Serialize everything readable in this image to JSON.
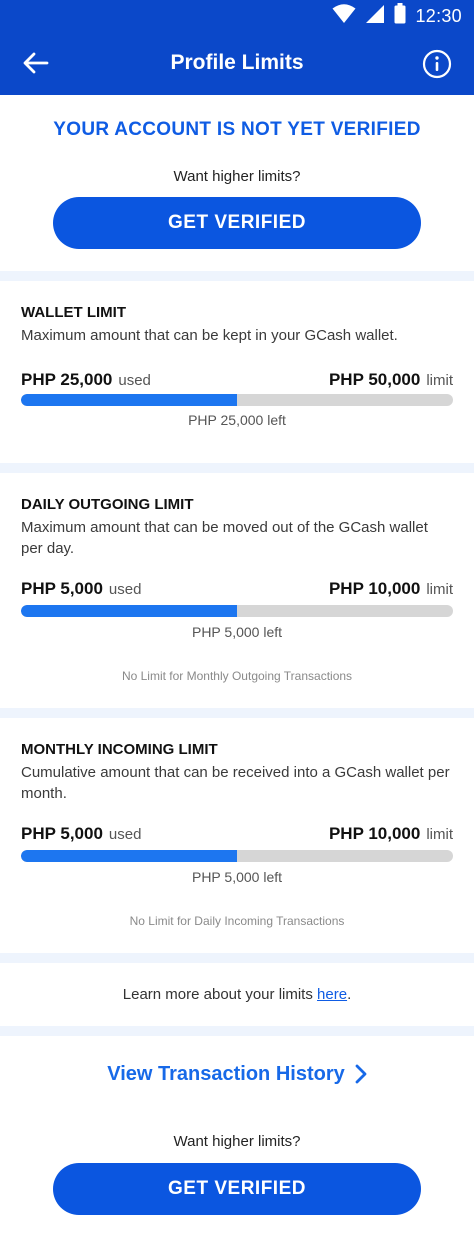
{
  "status_bar": {
    "time": "12:30"
  },
  "header": {
    "title": "Profile Limits"
  },
  "verification": {
    "heading": "YOUR ACCOUNT IS NOT YET VERIFIED",
    "prompt": "Want higher limits?",
    "button_label": "GET VERIFIED"
  },
  "limits": [
    {
      "title": "WALLET LIMIT",
      "description": "Maximum amount that can be kept in your GCash wallet.",
      "used_amount": "PHP 25,000",
      "used_label": "used",
      "limit_amount": "PHP 50,000",
      "limit_label": "limit",
      "progress_fraction": 0.5,
      "left_text": "PHP 25,000  left"
    },
    {
      "title": "DAILY OUTGOING LIMIT",
      "description": "Maximum amount that can be moved out of the GCash wallet per day.",
      "used_amount": "PHP 5,000",
      "used_label": "used",
      "limit_amount": "PHP 10,000",
      "limit_label": "limit",
      "progress_fraction": 0.5,
      "left_text": "PHP 5,000  left",
      "note": "No Limit for Monthly Outgoing Transactions"
    },
    {
      "title": "MONTHLY INCOMING LIMIT",
      "description": "Cumulative amount that can be received into a GCash wallet per month.",
      "used_amount": "PHP 5,000",
      "used_label": "used",
      "limit_amount": "PHP 10,000",
      "limit_label": "limit",
      "progress_fraction": 0.5,
      "left_text": "PHP 5,000  left",
      "note": "No Limit for Daily Incoming Transactions"
    }
  ],
  "learn_more": {
    "text": "Learn more about your limits ",
    "link": "here",
    "suffix": "."
  },
  "history": {
    "label": "View Transaction History"
  },
  "footer": {
    "prompt": "Want higher limits?",
    "button_label": "GET VERIFIED"
  },
  "colors": {
    "primary": "#0b48c9",
    "button": "#0b56e0",
    "progress": "#1d76f0",
    "track": "#d6d6d6"
  }
}
